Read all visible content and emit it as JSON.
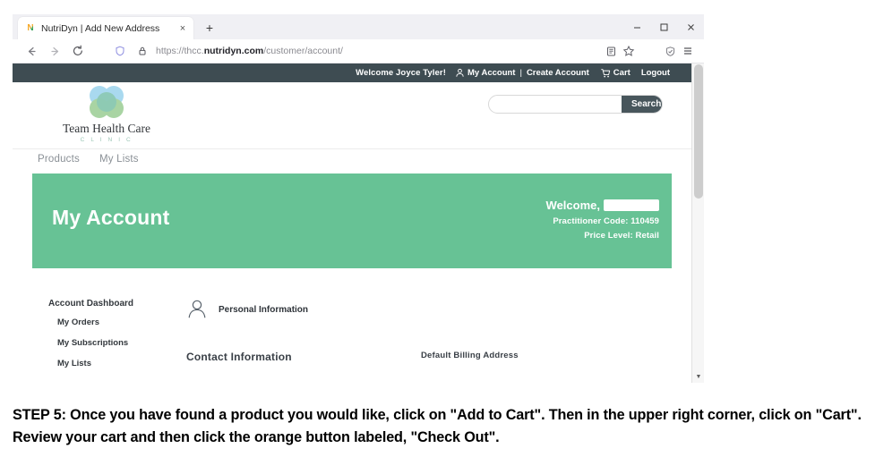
{
  "browser": {
    "tab": {
      "favicon": "nutridyn-n-favicon",
      "title": "NutriDyn | Add New Address",
      "close_label": "×"
    },
    "new_tab_label": "+",
    "window_controls": {
      "minimize": "—",
      "maximize": "❐",
      "close": "✕"
    },
    "toolbar": {
      "back": "←",
      "forward": "→",
      "reload": "⟳",
      "shield_icon": "shield-icon",
      "lock_icon": "padlock-icon",
      "url_prefix": "https://thcc.",
      "url_domain": "nutridyn.com",
      "url_path": "/customer/account/",
      "reader_icon": "reader-view-icon",
      "bookmark_icon": "bookmark-star-icon",
      "tracking_icon": "tracking-protection-icon",
      "menu_icon": "hamburger-menu-icon"
    }
  },
  "site": {
    "utility_bar": {
      "welcome": "Welcome Joyce Tyler!",
      "my_account": "My Account",
      "separator": "|",
      "create_account": "Create Account",
      "cart": "Cart",
      "logout": "Logout"
    },
    "logo": {
      "name": "Team Health Care",
      "subtitle": "C L I N I C"
    },
    "search": {
      "value": "",
      "placeholder": "",
      "button_label": "Search"
    },
    "main_nav": [
      {
        "label": "Products"
      },
      {
        "label": "My Lists"
      }
    ],
    "hero": {
      "title": "My Account",
      "welcome_prefix": "Welcome,",
      "welcome_name_redacted": true,
      "practitioner_code": "Practitioner Code: 110459",
      "price_level": "Price Level: Retail"
    },
    "sidebar": {
      "heading": "Account Dashboard",
      "items": [
        {
          "label": "My Orders"
        },
        {
          "label": "My Subscriptions"
        },
        {
          "label": "My Lists"
        }
      ]
    },
    "main": {
      "personal_information": "Personal Information",
      "contact_information": "Contact Information",
      "default_billing_address": "Default Billing Address"
    }
  },
  "colors": {
    "utility_bar": "#3E4C52",
    "hero_green": "#67C295",
    "search_button": "#48565C",
    "logo_blue": "#A9D9EF",
    "logo_green": "#A9D4A3",
    "logo_center": "#8CC9B4"
  },
  "caption": {
    "text": "STEP 5: Once you have found a product you would like, click on \"Add to Cart\". Then in the upper right corner, click on \"Cart\". Review your cart and then click the orange button labeled, \"Check Out\"."
  }
}
